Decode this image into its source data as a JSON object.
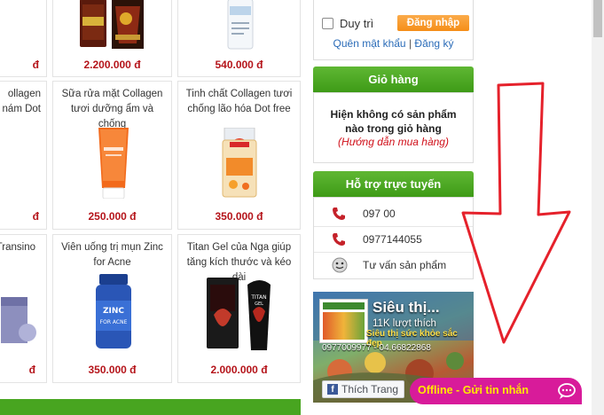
{
  "products": {
    "row1_prices": [
      "đ",
      "2.200.000 đ",
      "540.000 đ"
    ],
    "row2": [
      {
        "name": "ollagen\nnám Dot",
        "price": "đ"
      },
      {
        "name": "Sữa rửa mặt Collagen tươi dưỡng ẩm và chống",
        "price": "250.000 đ"
      },
      {
        "name": "Tinh chất Collagen tươi chống lão hóa Dot free",
        "price": "350.000 đ"
      }
    ],
    "row3": [
      {
        "name": "Transino",
        "price": "đ"
      },
      {
        "name": "Viên uống trị mụn Zinc for Acne",
        "price": "350.000 đ"
      },
      {
        "name": "Titan Gel của Nga giúp tăng kích thước và kéo dài",
        "price": "2.000.000 đ"
      }
    ],
    "zinc_label": "ZINC\nFOR ACNE",
    "titan_label": "TITAN\nGEL"
  },
  "login": {
    "remember_label": "Duy trì",
    "login_button": "Đăng nhập",
    "forgot_link": "Quên mật khẩu",
    "separator": "|",
    "register_link": "Đăng ký"
  },
  "cart": {
    "title": "Giỏ hàng",
    "empty_text": "Hiện không có sản phẩm nào trong giỏ hàng",
    "guide_link": "(Hướng dẫn mua hàng)"
  },
  "support": {
    "title": "Hỗ trợ trực tuyến",
    "rows": [
      {
        "text": "097 00",
        "icon": "phone-icon"
      },
      {
        "text": "0977144055",
        "icon": "phone-icon"
      },
      {
        "text": "Tư vấn sản phẩm",
        "icon": "chat-face-icon"
      }
    ]
  },
  "facebook": {
    "page_name": "Siêu thị...",
    "likes": "11K lượt thích",
    "tagline": "Siêu thị sức khỏe sắc đẹp",
    "phones": "0977009977 - 04.66822868",
    "like_button": "Thích Trang"
  },
  "chat_widget": {
    "label": "Offline - Gửi tin nhắn",
    "icon": "chat-bubble-icon"
  },
  "colors": {
    "price_red": "#b5151b",
    "sidebar_green": "#4aa821",
    "login_orange": "#f7941d",
    "chat_magenta": "#d81b9a",
    "arrow_red": "#e5212b"
  }
}
